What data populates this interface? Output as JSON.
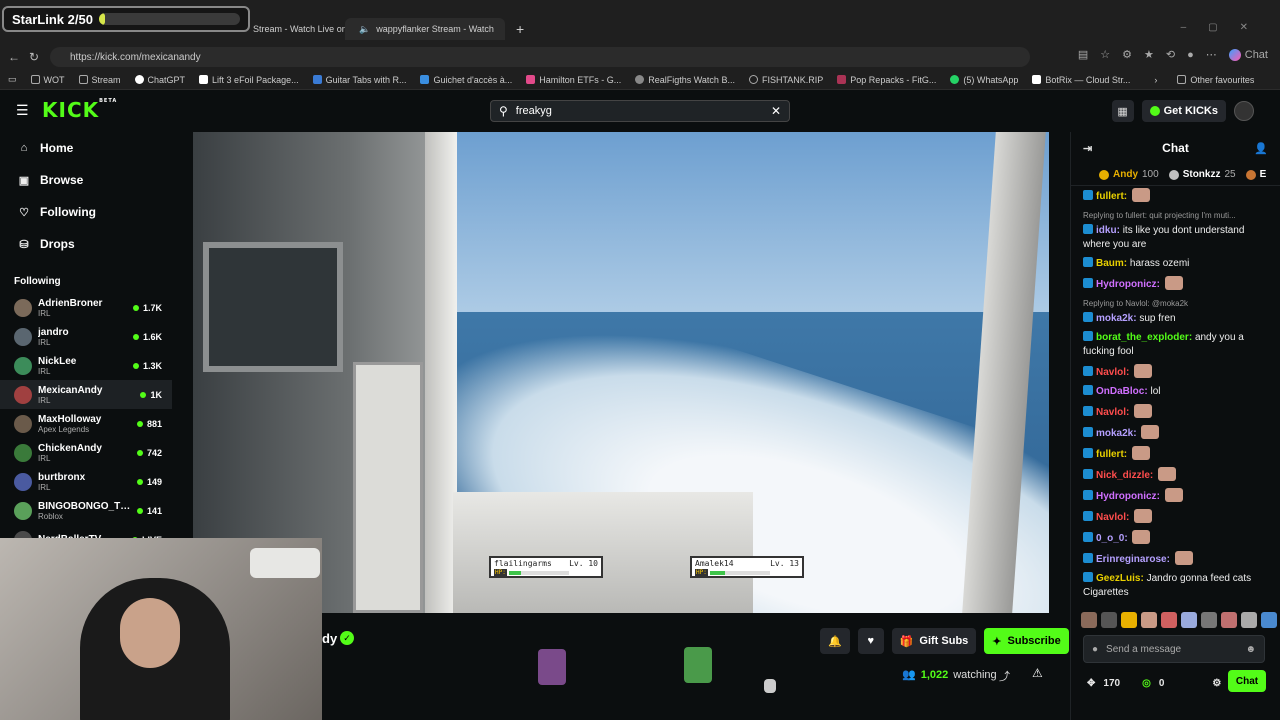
{
  "overlay": {
    "counter_label": "StarLink 2/50",
    "progress": 0.04
  },
  "browser": {
    "tabs": [
      {
        "title": "Stream - Watch Live on",
        "icon": "kick-favicon-icon"
      },
      {
        "title": "wappyflanker Stream - Watch",
        "icon": "kick-favicon-icon"
      }
    ],
    "url": "https://kick.com/mexicanandy",
    "copilot_label": "Chat",
    "bookmarks": [
      {
        "label": "WOT"
      },
      {
        "label": "Stream"
      },
      {
        "label": "ChatGPT"
      },
      {
        "label": "Lift 3 eFoil Package..."
      },
      {
        "label": "Guitar Tabs with R..."
      },
      {
        "label": "Guichet d'accès à..."
      },
      {
        "label": "Hamilton ETFs - G..."
      },
      {
        "label": "RealFigths Watch B..."
      },
      {
        "label": "FISHTANK.RIP"
      },
      {
        "label": "Pop Repacks - FitG..."
      },
      {
        "label": "(5) WhatsApp"
      },
      {
        "label": "BotRix — Cloud Str..."
      }
    ],
    "other_favourites": "Other favourites"
  },
  "header": {
    "logo": "KICK",
    "logo_badge": "BETA",
    "search_value": "freakyg",
    "get_kicks": "Get KICKs"
  },
  "sidebar": {
    "nav": [
      {
        "label": "Home",
        "icon": "home-icon"
      },
      {
        "label": "Browse",
        "icon": "browse-icon"
      },
      {
        "label": "Following",
        "icon": "heart-icon"
      },
      {
        "label": "Drops",
        "icon": "drops-icon"
      }
    ],
    "following_label": "Following",
    "channels": [
      {
        "name": "AdrienBroner",
        "category": "IRL",
        "viewers": "1.7K",
        "color": "#7b6a5a"
      },
      {
        "name": "jandro",
        "category": "IRL",
        "viewers": "1.6K",
        "color": "#5a6670"
      },
      {
        "name": "NickLee",
        "category": "IRL",
        "viewers": "1.3K",
        "color": "#3c8c5a"
      },
      {
        "name": "MexicanAndy",
        "category": "IRL",
        "viewers": "1K",
        "color": "#a04040"
      },
      {
        "name": "MaxHolloway",
        "category": "Apex Legends",
        "viewers": "881",
        "color": "#6a5a4a"
      },
      {
        "name": "ChickenAndy",
        "category": "IRL",
        "viewers": "742",
        "color": "#3a7a3a"
      },
      {
        "name": "burtbronx",
        "category": "IRL",
        "viewers": "149",
        "color": "#4a5aa0"
      },
      {
        "name": "BINGOBONGO_TWI...",
        "category": "Roblox",
        "viewers": "141",
        "color": "#5aa05a"
      },
      {
        "name": "NerdBallerTV",
        "category": "",
        "viewers": "LIVE",
        "color": "#4a4a4a"
      }
    ]
  },
  "video": {
    "hp_boxes": [
      {
        "name": "flailingarms",
        "level": "Lv. 10",
        "hp_label": "HP:",
        "hp": 0.2
      },
      {
        "name": "Amalek14",
        "level": "Lv. 13",
        "hp_label": "HP:",
        "hp": 0.25
      }
    ]
  },
  "stream_info": {
    "name_fragment": "dy",
    "buttons": {
      "gift": "Gift Subs",
      "subscribe": "Subscribe"
    },
    "watching_count": "1,022",
    "watching_label": "watching"
  },
  "chat": {
    "title": "Chat",
    "leaders": [
      {
        "name": "Andy",
        "value": "100",
        "color": "#e8b000"
      },
      {
        "name": "Stonkzz",
        "value": "25",
        "color": "#c0c0c0"
      },
      {
        "name": "E",
        "value": "",
        "color": "#c87533"
      }
    ],
    "messages": [
      {
        "user": "fullert",
        "color": "#e8d000",
        "text": "",
        "reply": ""
      },
      {
        "user": "idku",
        "color": "#b5a0ff",
        "text": "its like you dont understand where you are",
        "reply": "Replying to fullert: quit projecting I'm muti..."
      },
      {
        "user": "Baum",
        "color": "#e8d000",
        "text": "harass ozemi",
        "reply": ""
      },
      {
        "user": "Hydroponicz",
        "color": "#d070ff",
        "text": "",
        "reply": ""
      },
      {
        "user": "moka2k",
        "color": "#b5a0ff",
        "text": "sup fren",
        "reply": "Replying to Navlol: @moka2k"
      },
      {
        "user": "borat_the_exploder",
        "color": "#53fc18",
        "text": "andy you a fucking fool",
        "reply": ""
      },
      {
        "user": "Navlol",
        "color": "#ff4d4d",
        "text": "",
        "reply": ""
      },
      {
        "user": "OnDaBloc",
        "color": "#d070ff",
        "text": "lol",
        "reply": ""
      },
      {
        "user": "Navlol",
        "color": "#ff4d4d",
        "text": "",
        "reply": ""
      },
      {
        "user": "moka2k",
        "color": "#b5a0ff",
        "text": "",
        "reply": ""
      },
      {
        "user": "fullert",
        "color": "#e8d000",
        "text": "",
        "reply": ""
      },
      {
        "user": "Nick_dizzle",
        "color": "#ff4d4d",
        "text": "",
        "reply": ""
      },
      {
        "user": "Hydroponicz",
        "color": "#d070ff",
        "text": "",
        "reply": ""
      },
      {
        "user": "Navlol",
        "color": "#ff4d4d",
        "text": "",
        "reply": ""
      },
      {
        "user": "0_o_0",
        "color": "#b5a0ff",
        "text": "",
        "reply": ""
      },
      {
        "user": "Erinreginarose",
        "color": "#b5a0ff",
        "text": "",
        "reply": ""
      },
      {
        "user": "GeezLuis",
        "color": "#e8d000",
        "text": "Jandro gonna feed cats Cigarettes",
        "reply": ""
      }
    ],
    "input_placeholder": "Send a message",
    "footer_count": "170",
    "footer_points": "0",
    "send_label": "Chat"
  }
}
